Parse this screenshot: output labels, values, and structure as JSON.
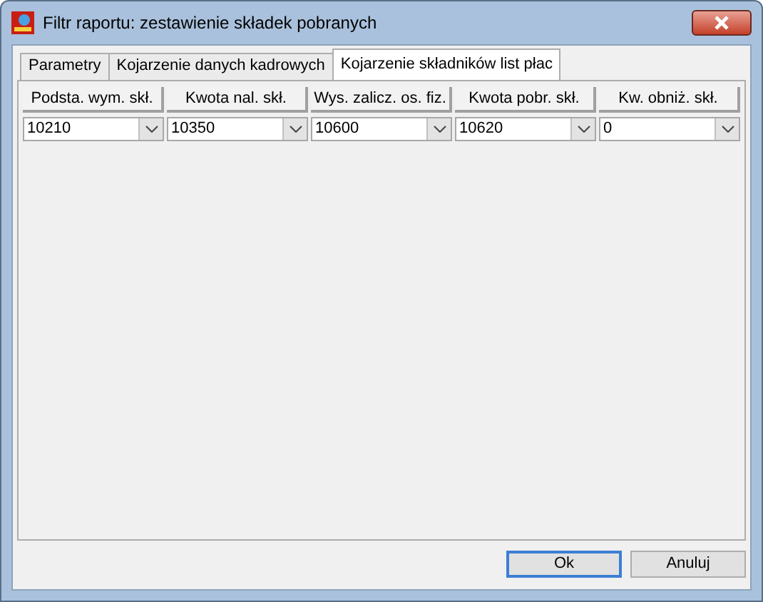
{
  "window": {
    "title": "Filtr raportu: zestawienie składek pobranych"
  },
  "tabs": [
    {
      "label": "Parametry",
      "selected": false
    },
    {
      "label": "Kojarzenie danych kadrowych",
      "selected": false
    },
    {
      "label": "Kojarzenie składników list płac",
      "selected": true
    }
  ],
  "table": {
    "columns": [
      "Podsta. wym. skł.",
      "Kwota nal. skł.",
      "Wys. zalicz. os. fiz.",
      "Kwota pobr. skł.",
      "Kw. obniż. skł."
    ],
    "values": [
      "10210",
      "10350",
      "10600",
      "10620",
      "0"
    ]
  },
  "buttons": [
    {
      "label": "Ok",
      "default": true
    },
    {
      "label": "Anuluj",
      "default": false
    }
  ]
}
